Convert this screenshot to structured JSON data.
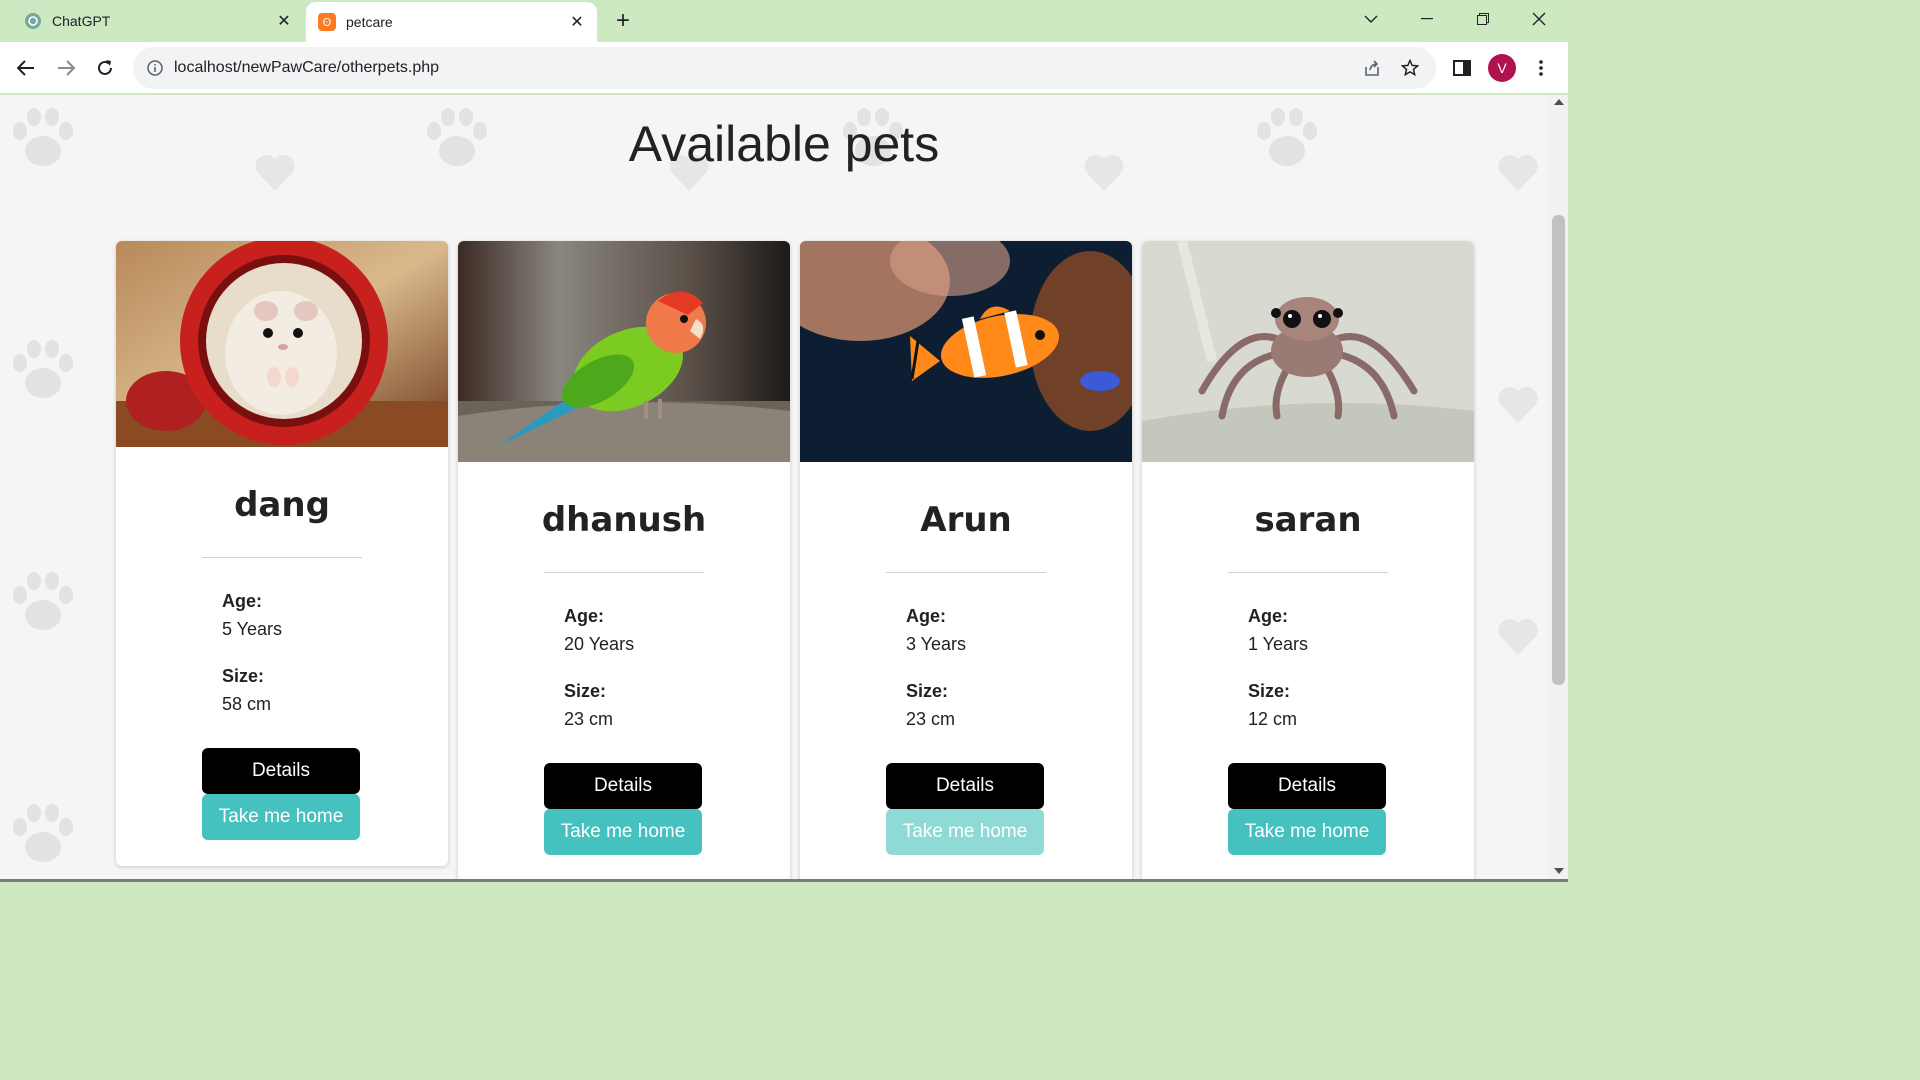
{
  "browser": {
    "tabs": [
      {
        "label": "ChatGPT",
        "icon": "chatgpt-icon"
      },
      {
        "label": "petcare",
        "icon": "xampp-icon"
      }
    ],
    "url": "localhost/newPawCare/otherpets.php",
    "profile_initial": "V"
  },
  "page": {
    "title": "Available pets",
    "age_label": "Age:",
    "size_label": "Size:",
    "details_label": "Details",
    "adopt_label": "Take me home"
  },
  "pets": [
    {
      "name": "dang",
      "age": "5 Years",
      "size": "58 cm",
      "image": "hamster-in-red-mug"
    },
    {
      "name": "dhanush",
      "age": "20 Years",
      "size": "23 cm",
      "image": "green-lovebird"
    },
    {
      "name": "Arun",
      "age": "3 Years",
      "size": "23 cm",
      "image": "clownfish"
    },
    {
      "name": "saran",
      "age": "1 Years",
      "size": "12 cm",
      "image": "jumping-spider"
    }
  ],
  "colors": {
    "tabstrip": "#cde9c1",
    "details_button": "#000000",
    "adopt_button": "#45c1bf",
    "adopt_button_faded": "#8fd9d6",
    "avatar": "#b0124f"
  }
}
